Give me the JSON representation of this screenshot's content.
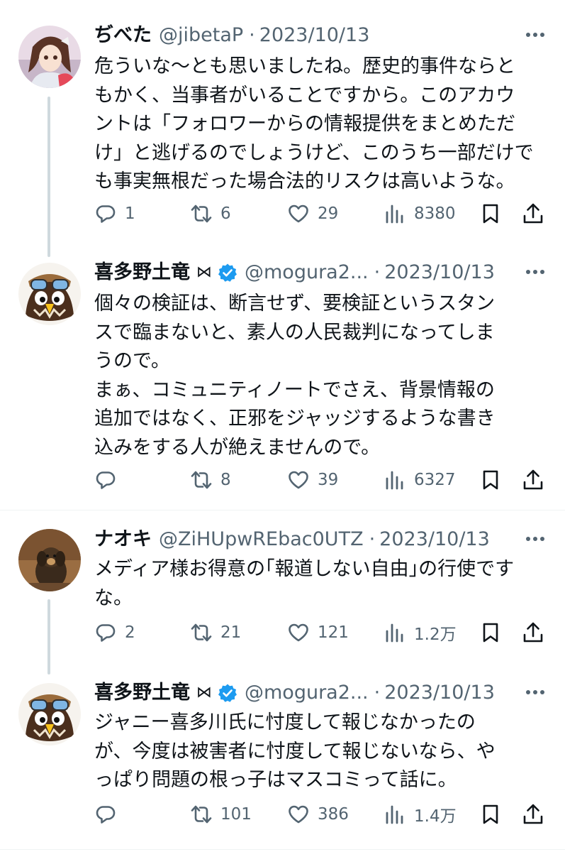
{
  "tweets": [
    {
      "name": "ぢべた",
      "handle": "@jibetaP",
      "sep": "·",
      "date": "2023/10/13",
      "body": "危ういな〜とも思いましたね。歴史的事件ならと\nもかく、当事者がいることですから。このアカウ\nントは「フォロワーからの情報提供をまとめただ\nけ」と逃げるのでしょうけど、このうち一部だけで\nも事実無根だった場合法的リスクは高いような。",
      "replies": "1",
      "retweets": "6",
      "likes": "29",
      "views": "8380"
    },
    {
      "name": "喜多野土竜",
      "ext": "⋈",
      "verified": true,
      "handle": "@mogura2...",
      "sep": "·",
      "date": "2023/10/13",
      "body": "個々の検証は、断言せず、要検証というスタン\nスで臨まないと、素人の人民裁判になってしま\nうので。\nまぁ、コミュニティノートでさえ、背景情報の\n追加ではなく、正邪をジャッジするような書き\n込みをする人が絶えませんので。",
      "replies": "",
      "retweets": "8",
      "likes": "39",
      "views": "6327"
    },
    {
      "name": "ナオキ",
      "handle": "@ZiHUpwREbac0UTZ",
      "sep": "·",
      "date": "2023/10/13",
      "body": "メディア様お得意の｢報道しない自由｣の行使です\nな。",
      "replies": "2",
      "retweets": "21",
      "likes": "121",
      "views": "1.2万"
    },
    {
      "name": "喜多野土竜",
      "ext": "⋈",
      "verified": true,
      "handle": "@mogura2...",
      "sep": "·",
      "date": "2023/10/13",
      "body": "ジャニー喜多川氏に忖度して報じなかったの\nが、今度は被害者に忖度して報じないなら、や\nっぱり問題の根っ子はマスコミって話に。",
      "replies": "",
      "retweets": "101",
      "likes": "386",
      "views": "1.4万"
    }
  ],
  "colors": {
    "text": "#0f1419",
    "secondary": "#536471",
    "verified": "#1d9bf0",
    "line": "#cfd9de"
  },
  "icons": [
    "more-icon",
    "reply-icon",
    "retweet-icon",
    "like-icon",
    "views-icon",
    "bookmark-icon",
    "share-icon",
    "verified-badge-icon"
  ]
}
